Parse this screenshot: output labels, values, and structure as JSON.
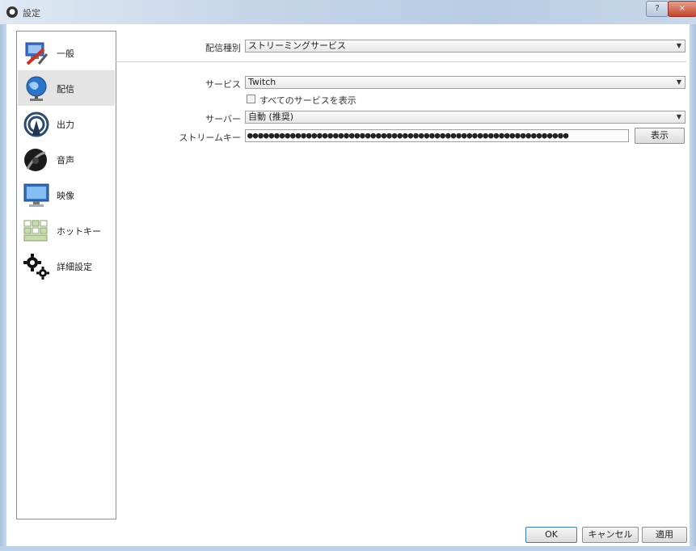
{
  "window": {
    "title": "設定",
    "minimize_glyph": "?",
    "close_glyph": "×"
  },
  "sidebar": {
    "items": [
      {
        "label": "一般",
        "icon": "general-icon"
      },
      {
        "label": "配信",
        "icon": "globe-stream-icon",
        "selected": true
      },
      {
        "label": "出力",
        "icon": "broadcast-output-icon"
      },
      {
        "label": "音声",
        "icon": "speaker-audio-icon"
      },
      {
        "label": "映像",
        "icon": "monitor-video-icon"
      },
      {
        "label": "ホットキー",
        "icon": "keyboard-hotkey-icon"
      },
      {
        "label": "詳細設定",
        "icon": "gears-advanced-icon"
      }
    ]
  },
  "stream": {
    "type_label": "配信種別",
    "type_value": "ストリーミングサービス",
    "service_label": "サービス",
    "service_value": "Twitch",
    "show_all_label": "すべてのサービスを表示",
    "server_label": "サーバー",
    "server_value": "自動 (推奨)",
    "key_label": "ストリームキー",
    "key_value": "●●●●●●●●●●●●●●●●●●●●●●●●●●●●●●●●●●●●●●●●●●●●●●●●●●●●●●●●●●●●",
    "show_button": "表示"
  },
  "footer": {
    "ok": "OK",
    "cancel": "キャンセル",
    "apply": "適用"
  },
  "colors": {
    "selected_bg": "#e4e4e4",
    "title_gradient_end": "#b8cce4",
    "close_red": "#c5452d"
  }
}
